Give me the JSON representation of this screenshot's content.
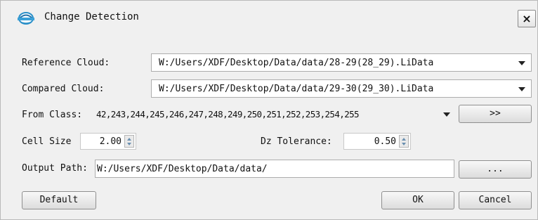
{
  "window": {
    "title": "Change Detection",
    "close_label": "×",
    "icon": "app-logo-icon"
  },
  "reference_cloud": {
    "label": "Reference Cloud:",
    "value": "W:/Users/XDF/Desktop/Data/data/28-29(28_29).LiData"
  },
  "compared_cloud": {
    "label": "Compared Cloud:",
    "value": "W:/Users/XDF/Desktop/Data/data/29-30(29_30).LiData"
  },
  "from_class": {
    "label": "From Class:",
    "value": "42,243,244,245,246,247,248,249,250,251,252,253,254,255",
    "button_label": ">>"
  },
  "cell_size": {
    "label": "Cell Size",
    "value": "2.00"
  },
  "dz_tolerance": {
    "label": "Dz Tolerance:",
    "value": "0.50"
  },
  "output_path": {
    "label": "Output Path:",
    "value": "W:/Users/XDF/Desktop/Data/data/",
    "browse_label": "..."
  },
  "buttons": {
    "default_label": "Default",
    "ok_label": "OK",
    "cancel_label": "Cancel"
  }
}
